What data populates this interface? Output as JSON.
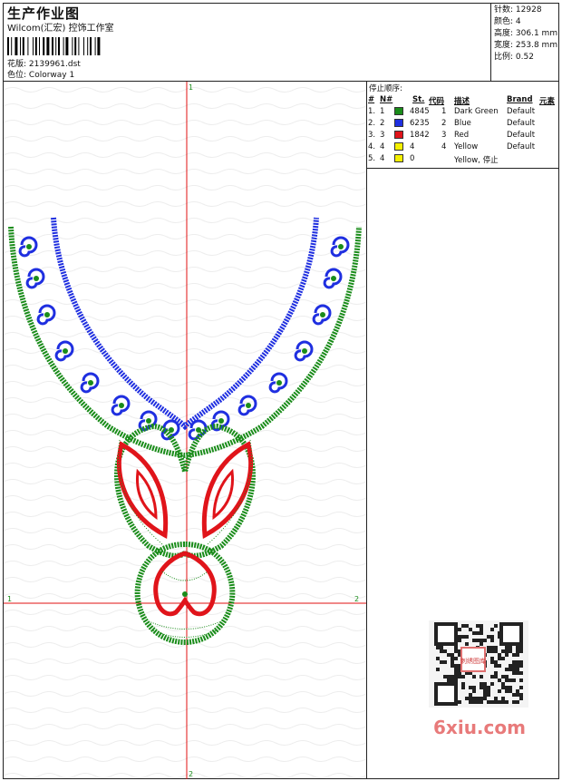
{
  "header": {
    "title": "生产作业图",
    "company": "Wilcom(汇宏) 控饰工作室",
    "design_label": "花版:",
    "design_value": "2139961.dst",
    "color_label": "色位:",
    "color_value": "Colorway 1"
  },
  "stats": {
    "stitches_label": "针数:",
    "stitches_value": "12928",
    "colors_label": "颜色:",
    "colors_value": "4",
    "height_label": "高度:",
    "height_value": "306.1 mm",
    "width_label": "宽度:",
    "width_value": "253.8 mm",
    "ratio_label": "比例:",
    "ratio_value": "0.52"
  },
  "stop_sequence": {
    "title": "停止顺序:",
    "headers": {
      "hash": "#",
      "no": "N#",
      "st": "St.",
      "code": "代码",
      "desc": "描述",
      "brand": "Brand",
      "element": "元素"
    },
    "rows": [
      {
        "idx": "1.",
        "n": "1",
        "color": "#1a8c1a",
        "st": "4845",
        "code": "1",
        "desc": "Dark Green",
        "brand": "Default"
      },
      {
        "idx": "2.",
        "n": "2",
        "color": "#1f2fe0",
        "st": "6235",
        "code": "2",
        "desc": "Blue",
        "brand": "Default"
      },
      {
        "idx": "3.",
        "n": "3",
        "color": "#e0141a",
        "st": "1842",
        "code": "3",
        "desc": "Red",
        "brand": "Default"
      },
      {
        "idx": "4.",
        "n": "4",
        "color": "#f5f000",
        "st": "4",
        "code": "4",
        "desc": "Yellow",
        "brand": "Default"
      },
      {
        "idx": "5.",
        "n": "4",
        "color": "#f5f000",
        "st": "0",
        "code": "",
        "desc": "Yellow, 停止",
        "brand": ""
      }
    ]
  },
  "axes": {
    "top": "1",
    "bottom": "2",
    "left": "1",
    "right": "2"
  },
  "watermark": {
    "brand": "6xiu.com",
    "seal": "刺绣图库"
  },
  "colors": {
    "green": "#1a8c1a",
    "blue": "#1f2fe0",
    "red": "#e0141a",
    "axis": "#e01010"
  }
}
